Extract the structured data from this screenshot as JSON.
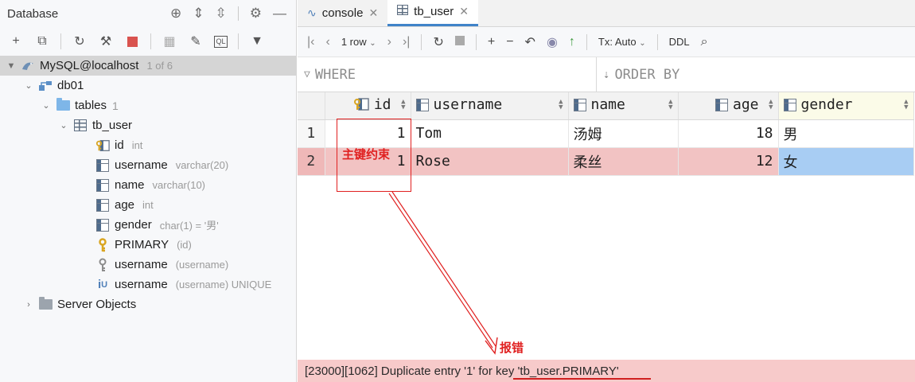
{
  "db_panel": {
    "title": "Database",
    "tree": {
      "connection": {
        "label": "MySQL@localhost",
        "meta": "1 of 6"
      },
      "schema": {
        "label": "db01"
      },
      "tables_folder": {
        "label": "tables",
        "count": "1"
      },
      "table": {
        "label": "tb_user"
      },
      "columns": [
        {
          "name": "id",
          "type": "int",
          "icon": "primary-key-column-icon"
        },
        {
          "name": "username",
          "type": "varchar(20)",
          "icon": "column-icon"
        },
        {
          "name": "name",
          "type": "varchar(10)",
          "icon": "column-icon"
        },
        {
          "name": "age",
          "type": "int",
          "icon": "column-icon"
        },
        {
          "name": "gender",
          "type": "char(1) = '男'",
          "icon": "column-icon"
        }
      ],
      "keys": [
        {
          "name": "PRIMARY",
          "meta": "(id)",
          "icon": "key-icon"
        },
        {
          "name": "username",
          "meta": "(username)",
          "icon": "unique-key-icon"
        },
        {
          "name": "username",
          "meta": "(username) UNIQUE",
          "icon": "unique-index-icon"
        }
      ],
      "server_objects": {
        "label": "Server Objects"
      }
    }
  },
  "tabs": [
    {
      "label": "console",
      "active": false
    },
    {
      "label": "tb_user",
      "active": true
    }
  ],
  "grid_toolbar": {
    "rows": "1 row",
    "tx": "Tx: Auto",
    "ddl": "DDL"
  },
  "filter": {
    "where": "WHERE",
    "order_by": "ORDER BY"
  },
  "grid": {
    "columns": [
      "id",
      "username",
      "name",
      "age",
      "gender"
    ],
    "rows": [
      {
        "num": "1",
        "id": "1",
        "username": "Tom",
        "name": "汤姆",
        "age": "18",
        "gender": "男"
      },
      {
        "num": "2",
        "id": "1",
        "username": "Rose",
        "name": "柔丝",
        "age": "12",
        "gender": "女"
      }
    ]
  },
  "error_message": "[23000][1062] Duplicate entry '1' for key 'tb_user.PRIMARY'",
  "annotations": {
    "pk_label": "主键约束",
    "error_label": "报错"
  },
  "colors": {
    "error_row": "#f2c3c3",
    "selected_cell": "#a8cdf3",
    "annotation": "#e02020",
    "active_tab": "#4083c9"
  }
}
